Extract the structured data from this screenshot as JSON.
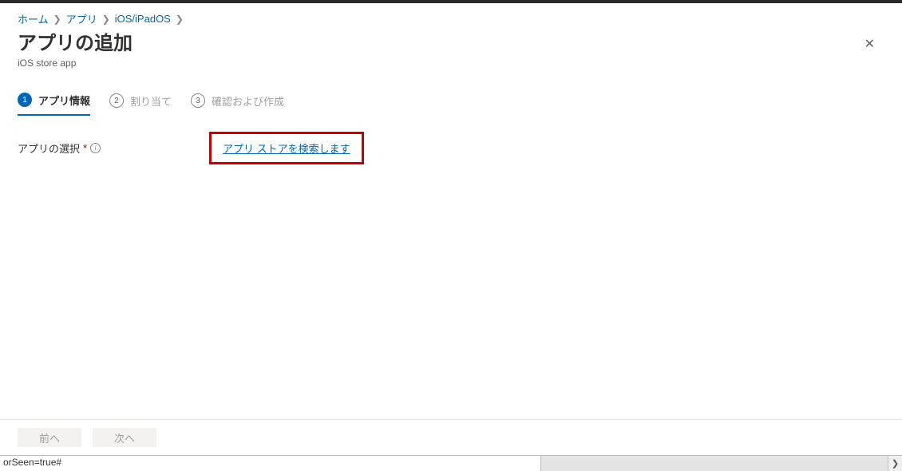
{
  "breadcrumb": {
    "items": [
      {
        "label": "ホーム"
      },
      {
        "label": "アプリ"
      },
      {
        "label": "iOS/iPadOS"
      }
    ]
  },
  "header": {
    "title": "アプリの追加",
    "subtitle": "iOS store app"
  },
  "tabs": [
    {
      "num": "1",
      "label": "アプリ情報",
      "active": true
    },
    {
      "num": "2",
      "label": "割り当て",
      "active": false
    },
    {
      "num": "3",
      "label": "確認および作成",
      "active": false
    }
  ],
  "form": {
    "app_select_label": "アプリの選択",
    "search_link": "アプリ ストアを検索します"
  },
  "footer": {
    "prev": "前へ",
    "next": "次へ"
  },
  "statusbar": {
    "text": "orSeen=true#"
  }
}
